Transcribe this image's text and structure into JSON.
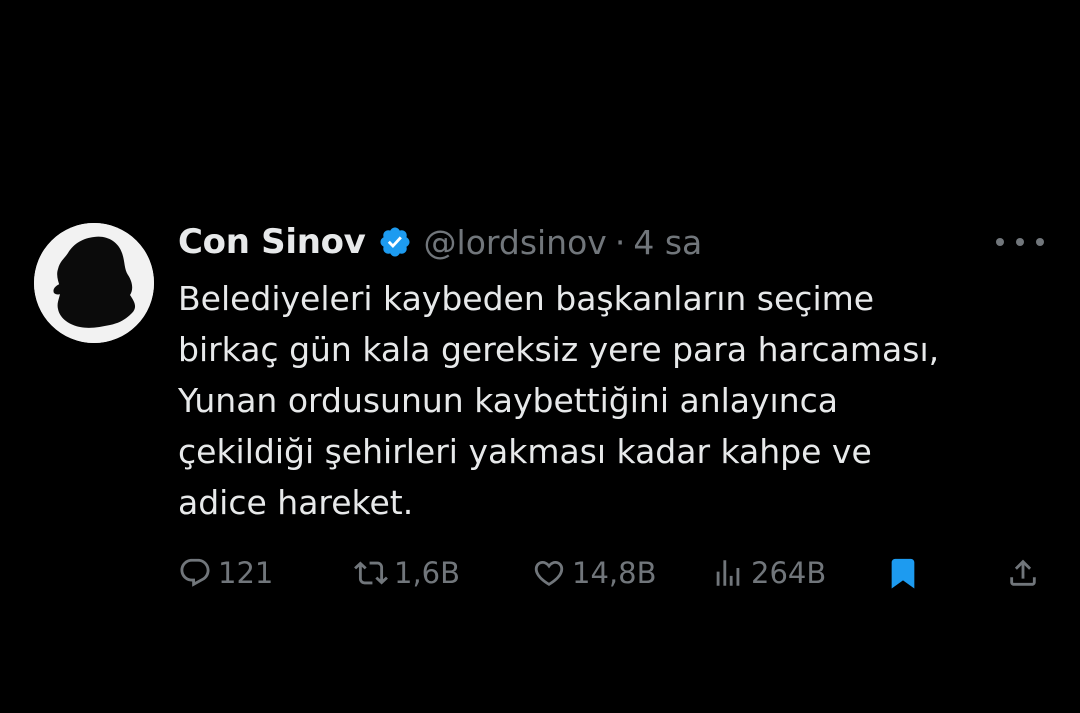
{
  "tweet": {
    "display_name": "Con Sinov",
    "handle": "@lordsinov",
    "separator": "·",
    "time": "4 sa",
    "text": "Belediyeleri kaybeden başkanların seçime\nbirkaç gün kala gereksiz yere para harcaması,\nYunan ordusunun kaybettiğini anlayınca\nçekildiği şehirleri yakması kadar kahpe ve\nadice hareket.",
    "verified": true
  },
  "actions": {
    "replies": "121",
    "retweets": "1,6B",
    "likes": "14,8B",
    "views": "264B",
    "bookmarked": true
  },
  "icons": {
    "reply": "reply-icon",
    "retweet": "retweet-icon",
    "like": "heart-icon",
    "views": "views-icon",
    "bookmark": "bookmark-icon",
    "share": "share-icon",
    "more": "more-icon",
    "verified": "verified-badge-icon"
  },
  "colors": {
    "background": "#000000",
    "text_primary": "#e7e9ea",
    "text_secondary": "#71767b",
    "accent": "#1d9bf0"
  }
}
